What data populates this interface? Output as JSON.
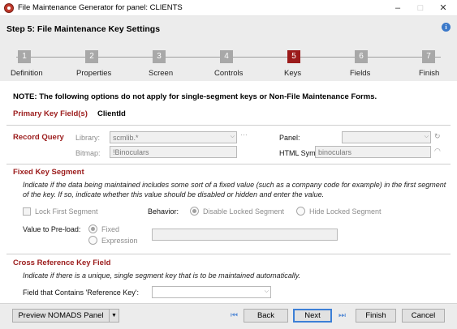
{
  "window": {
    "title": "File Maintenance Generator for panel: CLIENTS",
    "minimize": "–",
    "maximize": "□",
    "close": "✕"
  },
  "header": {
    "step_title": "Step 5: File Maintenance Key Settings",
    "info_icon": "i"
  },
  "steps": [
    {
      "num": "1",
      "label": "Definition"
    },
    {
      "num": "2",
      "label": "Properties"
    },
    {
      "num": "3",
      "label": "Screen"
    },
    {
      "num": "4",
      "label": "Controls"
    },
    {
      "num": "5",
      "label": "Keys"
    },
    {
      "num": "6",
      "label": "Fields"
    },
    {
      "num": "7",
      "label": "Finish"
    }
  ],
  "note": "NOTE: The following options do not apply for single-segment keys or Non-File Maintenance Forms.",
  "primary_key": {
    "label": "Primary Key Field(s)",
    "value": "ClientId"
  },
  "record_query": {
    "title": "Record Query",
    "library_label": "Library:",
    "library_value": "scmlib.*",
    "bitmap_label": "Bitmap:",
    "bitmap_value": "!Binoculars",
    "panel_label": "Panel:",
    "panel_value": "",
    "html_symbol_label": "HTML Symbol:",
    "html_symbol_value": "binoculars"
  },
  "fixed_key": {
    "title": "Fixed Key Segment",
    "description": "Indicate if the data being maintained includes some sort of a fixed value (such as a company code for example) in the first segment of the key. If so, indicate whether this value should be disabled or hidden and enter the value.",
    "lock_label": "Lock First Segment",
    "behavior_label": "Behavior:",
    "disable_label": "Disable Locked Segment",
    "hide_label": "Hide Locked Segment",
    "preload_label": "Value to Pre-load:",
    "fixed_label": "Fixed",
    "expression_label": "Expression",
    "preload_value": ""
  },
  "cross_ref": {
    "title": "Cross Reference Key Field",
    "description": "Indicate if there is a unique, single segment key that is to be maintained automatically.",
    "field_label": "Field that Contains 'Reference Key':",
    "field_value": ""
  },
  "footer": {
    "preview_label": "Preview NOMADS Panel",
    "preview_arrow": "▼",
    "first_icon": "⏮",
    "back_label": "Back",
    "next_label": "Next",
    "last_icon": "⏭",
    "finish_label": "Finish",
    "cancel_label": "Cancel"
  },
  "colors": {
    "accent": "#9b1b1b",
    "header_bg": "#ececec"
  }
}
